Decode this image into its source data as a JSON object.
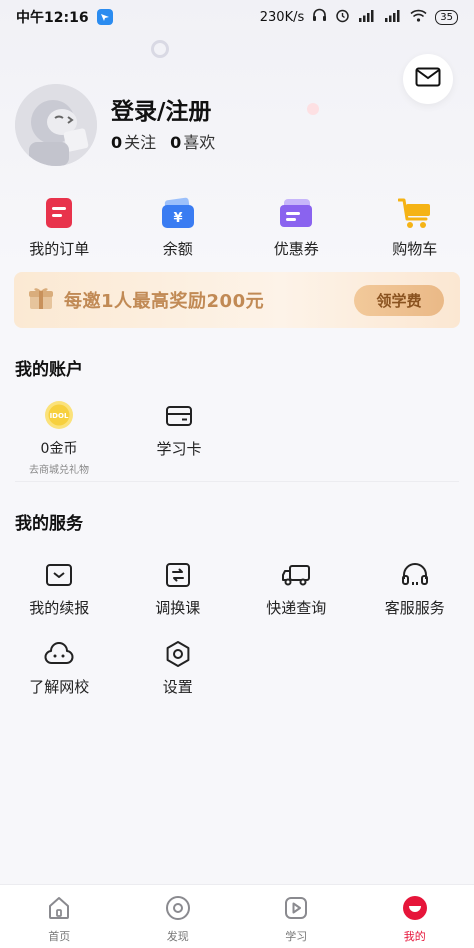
{
  "status_bar": {
    "time": "中午12:16",
    "network_speed": "230K/s",
    "battery": "35"
  },
  "profile": {
    "login_label": "登录/注册",
    "following_count": "0",
    "following_label": "关注",
    "likes_count": "0",
    "likes_label": "喜欢"
  },
  "quick_actions": [
    {
      "label": "我的订单",
      "icon": "order-icon",
      "color": "#e8334c"
    },
    {
      "label": "余额",
      "icon": "wallet-icon",
      "color": "#3a7cf2"
    },
    {
      "label": "优惠券",
      "icon": "coupon-icon",
      "color": "#8a63ef"
    },
    {
      "label": "购物车",
      "icon": "cart-icon",
      "color": "#f5b315"
    }
  ],
  "banner": {
    "text": "每邀1人最高奖励200元",
    "button": "领学费"
  },
  "account": {
    "title": "我的账户",
    "coins_label": "0金币",
    "coins_sub": "去商城兑礼物",
    "coin_badge": "IDOL",
    "card_label": "学习卡"
  },
  "services": {
    "title": "我的服务",
    "items": [
      {
        "label": "我的续报",
        "icon": "renewal-icon"
      },
      {
        "label": "调换课",
        "icon": "swap-course-icon"
      },
      {
        "label": "快递查询",
        "icon": "delivery-truck-icon"
      },
      {
        "label": "客服服务",
        "icon": "headset-icon"
      },
      {
        "label": "了解网校",
        "icon": "cloud-face-icon"
      },
      {
        "label": "设置",
        "icon": "settings-icon"
      }
    ]
  },
  "tabbar": {
    "items": [
      {
        "label": "首页",
        "icon": "home-icon"
      },
      {
        "label": "发现",
        "icon": "discover-icon"
      },
      {
        "label": "学习",
        "icon": "study-play-icon"
      },
      {
        "label": "我的",
        "icon": "me-icon"
      }
    ],
    "active": "我的",
    "accent": "#e6153a"
  }
}
